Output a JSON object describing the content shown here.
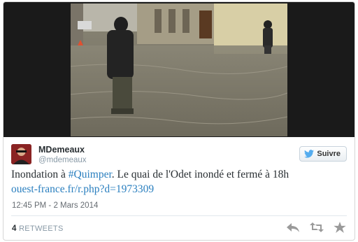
{
  "tweet": {
    "author_name": "MDemeaux",
    "author_handle": "@mdemeaux",
    "follow_label": "Suivre",
    "text_before": "Inondation à ",
    "hashtag": "#Quimper",
    "text_after": ". Le quai de l'Odet inondé et fermé à 18h",
    "link": "ouest-france.fr/r.php?d=1973309",
    "timestamp": "12:45 PM - 2 Mars 2014",
    "retweet_count": "4",
    "retweet_label": "RETWEETS"
  },
  "colors": {
    "link": "#2a7fbf",
    "text": "#292f33",
    "muted": "#8899a6",
    "twitter_blue": "#55acee"
  },
  "icons": [
    "twitter-bird-icon",
    "reply-icon",
    "retweet-icon",
    "favorite-star-icon"
  ]
}
